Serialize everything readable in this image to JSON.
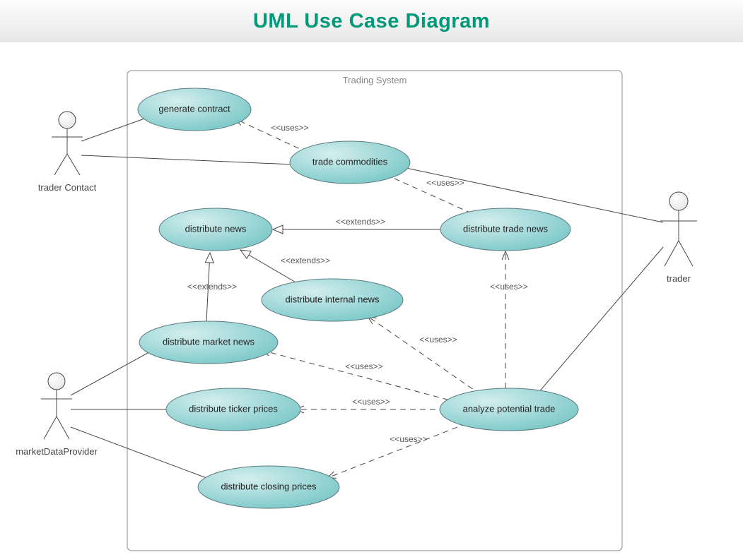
{
  "page": {
    "title": "UML Use Case Diagram"
  },
  "system": {
    "label": "Trading System"
  },
  "actors": {
    "traderContact": {
      "label": "trader Contact"
    },
    "trader": {
      "label": "trader"
    },
    "marketDataProvider": {
      "label": "marketDataProvider"
    }
  },
  "usecases": {
    "generateContract": "generate contract",
    "tradeCommodities": "trade commodities",
    "distributeNews": "distribute news",
    "distributeTradeNews": "distribute trade news",
    "distributeInternalNews": "distribute internal news",
    "distributeMarketNews": "distribute market news",
    "distributeTickerPrices": "distribute ticker prices",
    "analyzePotentialTrade": "analyze potential trade",
    "distributeClosingPrices": "distribute closing prices"
  },
  "stereotypes": {
    "uses": "<<uses>>",
    "extends": "<<extends>>"
  }
}
